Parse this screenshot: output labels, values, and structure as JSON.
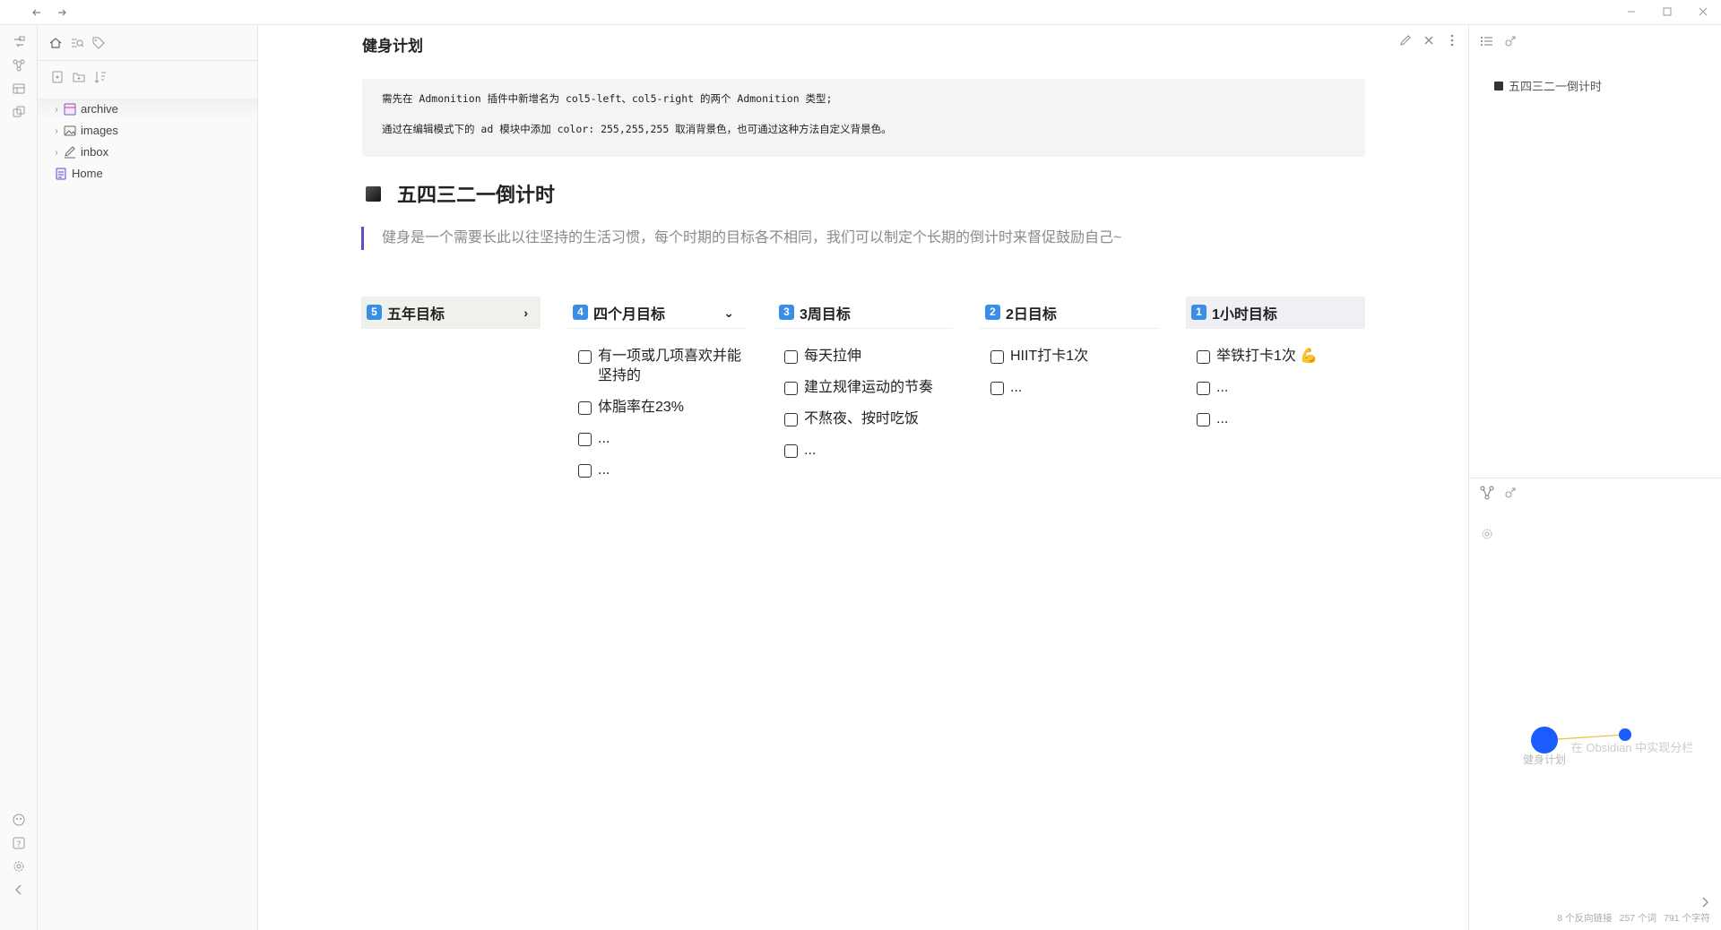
{
  "titlebar": {
    "back_icon": "arrow-left-icon",
    "forward_icon": "arrow-right-icon",
    "minimize_icon": "minimize-icon",
    "maximize_icon": "maximize-icon",
    "close_icon": "close-icon"
  },
  "ribbon": {
    "icons": [
      "switcher-icon",
      "graph-icon",
      "canvas-icon",
      "templates-icon",
      "vault-icon",
      "help-icon",
      "settings-icon",
      "collapse-icon"
    ]
  },
  "sidebar": {
    "tabs": [
      "home-icon",
      "search-icon",
      "tag-icon"
    ],
    "tools": [
      "new-note-icon",
      "new-folder-icon",
      "sort-icon"
    ],
    "tree": [
      {
        "label": "archive",
        "type": "folder",
        "icon": "archive-icon"
      },
      {
        "label": "images",
        "type": "folder",
        "icon": "image-icon"
      },
      {
        "label": "inbox",
        "type": "folder",
        "icon": "pencil-icon"
      },
      {
        "label": "Home",
        "type": "file",
        "icon": "home-file-icon"
      }
    ]
  },
  "note": {
    "title": "健身计划",
    "code_lines": [
      "需先在 Admonition 插件中新增名为 col5-left、col5-right 的两个 Admonition 类型;",
      "通过在编辑模式下的 ad 模块中添加 color: 255,255,255 取消背景色，也可通过这种方法自定义背景色。"
    ],
    "heading": "五四三二一倒计时",
    "quote": "健身是一个需要长此以往坚持的生活习惯，每个时期的目标各不相同，我们可以制定个长期的倒计时来督促鼓励自己~",
    "columns": [
      {
        "badge": "5",
        "title": "五年目标",
        "chevron": "›",
        "tasks": []
      },
      {
        "badge": "4",
        "title": "四个月目标",
        "chevron": "⌄",
        "tasks": [
          "有一项或几项喜欢并能坚持的",
          "体脂率在23%",
          "...",
          "..."
        ]
      },
      {
        "badge": "3",
        "title": "3周目标",
        "chevron": "",
        "tasks": [
          "每天拉伸",
          "建立规律运动的节奏",
          "不熬夜、按时吃饭",
          "..."
        ]
      },
      {
        "badge": "2",
        "title": "2日目标",
        "chevron": "",
        "tasks": [
          "HIIT打卡1次",
          "..."
        ]
      },
      {
        "badge": "1",
        "title": "1小时目标",
        "chevron": "",
        "tasks": [
          "举铁打卡1次 💪",
          "...",
          "..."
        ]
      }
    ]
  },
  "right_panel": {
    "outline_item": "五四三二一倒计时",
    "graph_nodes": [
      "健身计划",
      "在 Obsidian 中实现分栏"
    ],
    "status": [
      "8 个反向链接",
      "257 个词",
      "791 个字符"
    ]
  }
}
